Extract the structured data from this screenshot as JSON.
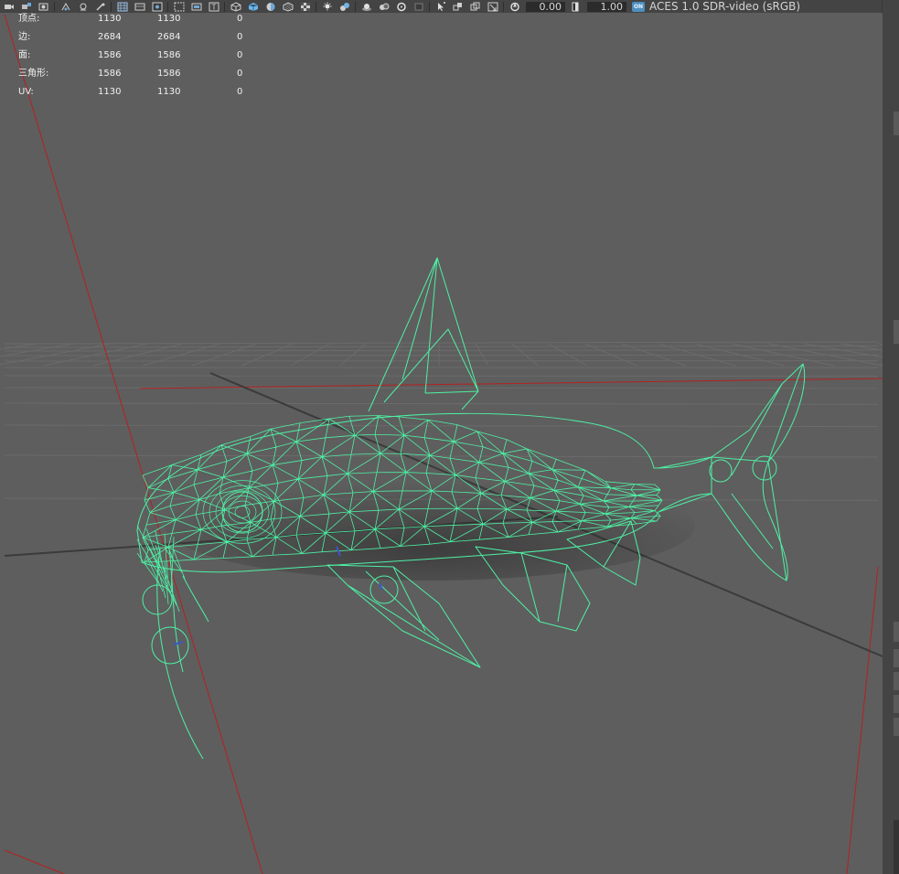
{
  "toolbar": {
    "icons": [
      "camera-icon",
      "camera-attr-icon",
      "bookmark-icon",
      "film-icon",
      "image-plane-icon",
      "grid-icon",
      "film-gate-icon",
      "resolution-gate-icon",
      "gate-mask-icon",
      "field-chart-icon",
      "safe-action-icon",
      "safe-title-icon",
      "wireframe-icon",
      "smooth-shade-icon",
      "default-material-icon",
      "textured-icon",
      "use-lights-icon",
      "shadows-icon",
      "ambient-occlusion-icon",
      "motion-blur-icon",
      "antialias-icon",
      "depth-of-field-icon",
      "isolate-select-icon",
      "xray-icon",
      "xray-joints-icon",
      "backface-icon"
    ],
    "exposure_value": "0.00",
    "gamma_value": "1.00",
    "color_management_toggle": "ON",
    "view_transform": "ACES 1.0 SDR-video (sRGB)"
  },
  "hud": {
    "rows": [
      {
        "label": "顶点:",
        "v1": "1130",
        "v2": "1130",
        "v3": "0"
      },
      {
        "label": "边:",
        "v1": "2684",
        "v2": "2684",
        "v3": "0"
      },
      {
        "label": "面:",
        "v1": "1586",
        "v2": "1586",
        "v3": "0"
      },
      {
        "label": "三角形:",
        "v1": "1586",
        "v2": "1586",
        "v3": "0"
      },
      {
        "label": "UV:",
        "v1": "1130",
        "v2": "1130",
        "v3": "0"
      }
    ]
  },
  "viewport": {
    "background_color": "#5e5e5e",
    "grid_color": "#6b6b6b",
    "axis_x_color": "#b02020",
    "axis_z_color": "#3a3a3a",
    "wireframe_color": "#4ef0a4"
  }
}
